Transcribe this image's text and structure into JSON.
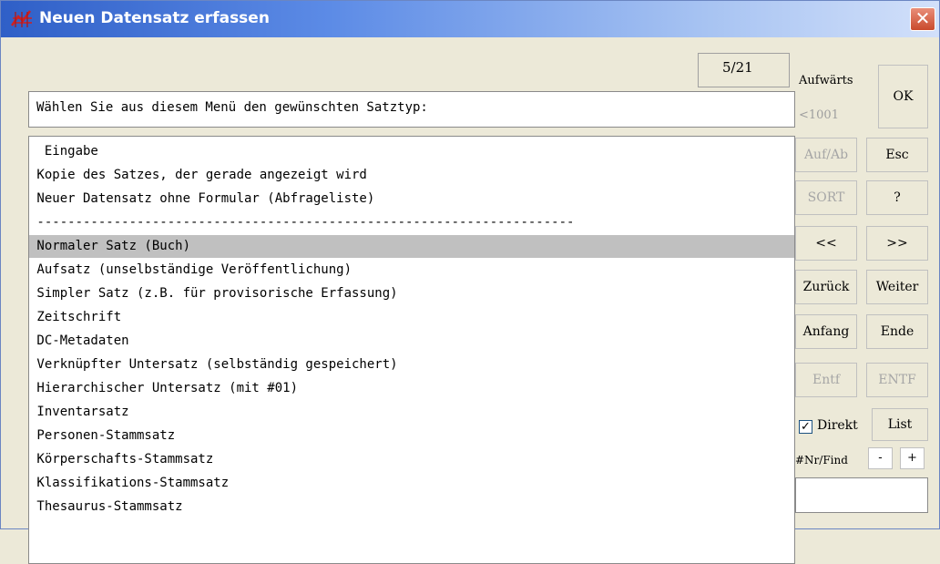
{
  "window": {
    "title": "Neuen Datensatz erfassen",
    "close_symbol": "✕",
    "app_icon": "graph-icon",
    "close_icon": "close-icon"
  },
  "counter": "5/21",
  "prompt": "Wählen Sie aus diesem Menü den gewünschten Satztyp:",
  "list": {
    "selected_index": 4,
    "items": [
      "  Eingabe",
      " Kopie des Satzes, der gerade angezeigt wird",
      " Neuer Datensatz ohne Formular (Abfrageliste)",
      " ----------------------------------------------------------------------",
      " Normaler Satz (Buch)",
      " Aufsatz (unselbständige Veröffentlichung)",
      " Simpler Satz (z.B. für provisorische Erfassung)",
      " Zeitschrift",
      " DC-Metadaten",
      " Verknüpfter Untersatz (selbständig gespeichert)",
      " Hierarchischer Untersatz (mit #01)",
      " Inventarsatz",
      " Personen-Stammsatz",
      " Körperschafts-Stammsatz",
      " Klassifikations-Stammsatz",
      " Thesaurus-Stammsatz"
    ]
  },
  "side": {
    "aufwaerts_label": "Aufwärts",
    "aufwaerts_value": "<1001",
    "ok": "OK",
    "auf_ab": "Auf/Ab",
    "esc": "Esc",
    "sort": "SORT",
    "help": "?",
    "prev_page": "<<",
    "next_page": ">>",
    "zurueck": "Zurück",
    "weiter": "Weiter",
    "anfang": "Anfang",
    "ende": "Ende",
    "entf_lower": "Entf",
    "entf_upper": "ENTF",
    "direkt_label": "Direkt",
    "direkt_checked": "✓",
    "list": "List",
    "nr_find_label": "#Nr/Find",
    "minus": "-",
    "plus": "+"
  },
  "colors": {
    "titlebar_start": "#2f5fc7",
    "titlebar_end": "#d2e0fa",
    "window_bg": "#ece9d8",
    "selection": "#c0c0c0",
    "close_button": "#c94a2c"
  }
}
